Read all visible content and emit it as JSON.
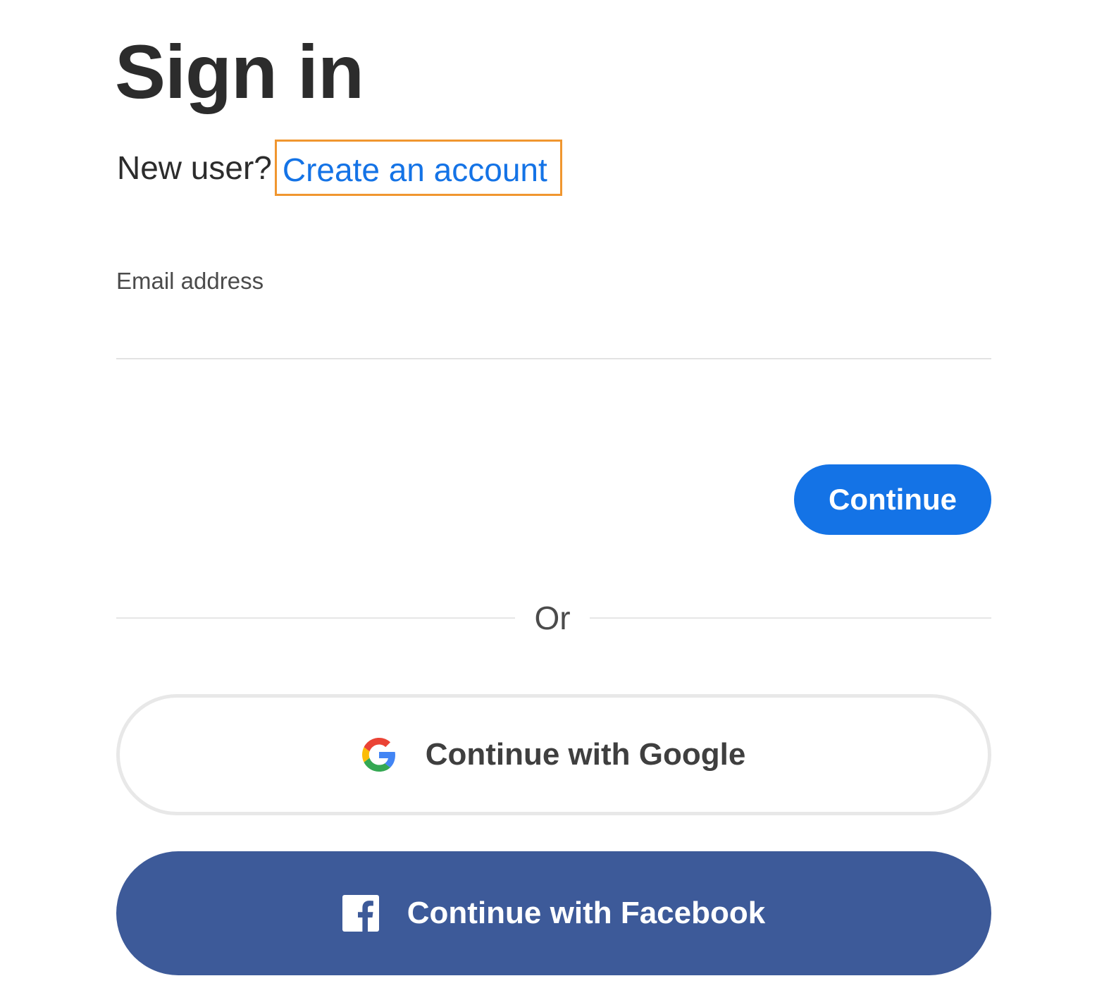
{
  "signin": {
    "title": "Sign in",
    "new_user_prompt": "New user?",
    "create_account_link": "Create an account",
    "email_label": "Email address",
    "email_value": "",
    "continue_label": "Continue",
    "divider_text": "Or",
    "google_label": "Continue with Google",
    "facebook_label": "Continue with Facebook"
  },
  "icons": {
    "google": "google-icon",
    "facebook": "facebook-icon"
  },
  "colors": {
    "accent_blue": "#1473e6",
    "facebook_blue": "#3d5a99",
    "highlight_orange": "#f0962f",
    "text_dark": "#2c2c2c"
  }
}
